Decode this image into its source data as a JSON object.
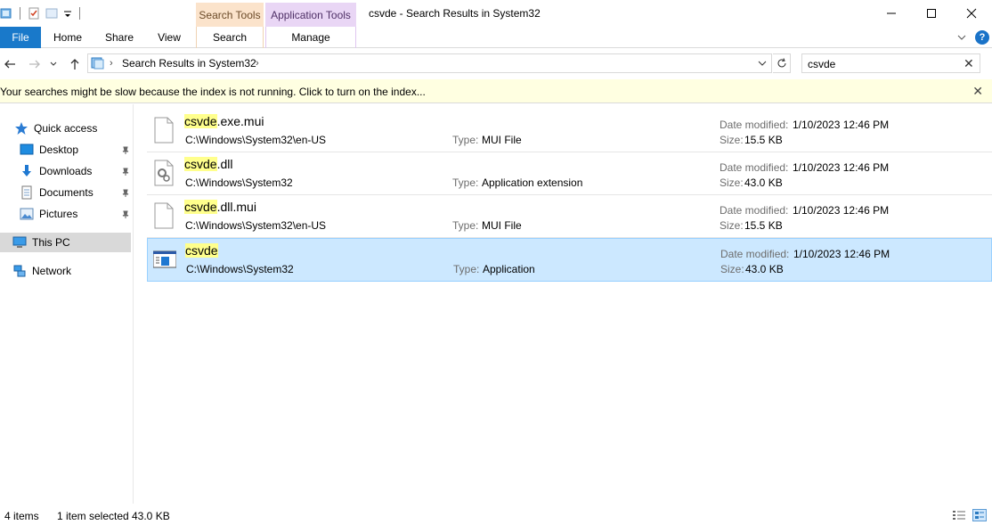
{
  "titlebar": {
    "title": "csvde - Search Results in System32",
    "context_tabs": {
      "search_tools": "Search Tools",
      "application_tools": "Application Tools"
    },
    "minimize_icon": "minimize-icon",
    "maximize_icon": "maximize-icon",
    "close_icon": "close-icon"
  },
  "ribbon": {
    "tabs": {
      "file": "File",
      "home": "Home",
      "share": "Share",
      "view": "View",
      "search": "Search",
      "manage": "Manage"
    },
    "help_label": "?",
    "file_tab_color": "#1979ca"
  },
  "address": {
    "crumb": "Search Results in System32"
  },
  "search": {
    "value": "csvde"
  },
  "infobar": {
    "message": "Your searches might be slow because the index is not running.  Click to turn on the index...",
    "background": "#ffffe1"
  },
  "nav": {
    "items": [
      {
        "label": "Quick access",
        "icon": "star-icon"
      },
      {
        "label": "Desktop",
        "icon": "desktop-icon"
      },
      {
        "label": "Downloads",
        "icon": "download-icon"
      },
      {
        "label": "Documents",
        "icon": "documents-icon"
      },
      {
        "label": "Pictures",
        "icon": "pictures-icon"
      },
      {
        "label": "This PC",
        "icon": "computer-icon"
      },
      {
        "label": "Network",
        "icon": "network-icon"
      }
    ]
  },
  "labels": {
    "type": "Type:",
    "date_modified": "Date modified:",
    "size": "Size:"
  },
  "files": [
    {
      "name_match": "csvde",
      "name_rest": ".exe.mui",
      "path": "C:\\Windows\\System32\\en-US",
      "type": "MUI File",
      "date": "1/10/2023 12:46 PM",
      "size": "15.5 KB",
      "icon": "blank-file-icon"
    },
    {
      "name_match": "csvde",
      "name_rest": ".dll",
      "path": "C:\\Windows\\System32",
      "type": "Application extension",
      "date": "1/10/2023 12:46 PM",
      "size": "43.0 KB",
      "icon": "dll-file-icon"
    },
    {
      "name_match": "csvde",
      "name_rest": ".dll.mui",
      "path": "C:\\Windows\\System32\\en-US",
      "type": "MUI File",
      "date": "1/10/2023 12:46 PM",
      "size": "15.5 KB",
      "icon": "blank-file-icon"
    },
    {
      "name_match": "csvde",
      "name_rest": "",
      "path": "C:\\Windows\\System32",
      "type": "Application",
      "date": "1/10/2023 12:46 PM",
      "size": "43.0 KB",
      "icon": "application-icon"
    }
  ],
  "status": {
    "item_count": "4 items",
    "selected": "1 item selected",
    "selected_size": "43.0 KB"
  },
  "colors": {
    "selection_bg": "#cce8ff",
    "selection_border": "#99d1ff",
    "highlight": "#ffff8c"
  }
}
